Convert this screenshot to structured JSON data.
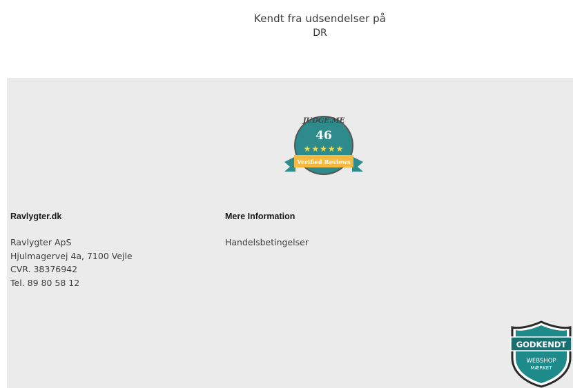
{
  "known_from": {
    "title": "Kendt fra udsendelser på",
    "channel": "DR"
  },
  "judgeme": {
    "brand": "JUDGE.ME",
    "count": "46",
    "stars": "★★★★★",
    "label": "Verified Reviews",
    "accent": "#2e8b8b",
    "ribbon": "#f5b942"
  },
  "footer": {
    "col1": {
      "title": "Ravlygter.dk",
      "lines": [
        "Ravlygter ApS",
        "Hjulmagervej 4a, 7100 Vejle",
        "CVR. 38376942",
        "Tel. 89 80 58 12"
      ]
    },
    "col2": {
      "title": "Mere Information",
      "links": [
        "Handelsbetingelser"
      ]
    }
  },
  "badge": {
    "line1": "GODKENDT",
    "line2": "WEBSHOP",
    "line3": "MÆRKET",
    "color": "#1f8a8a"
  }
}
